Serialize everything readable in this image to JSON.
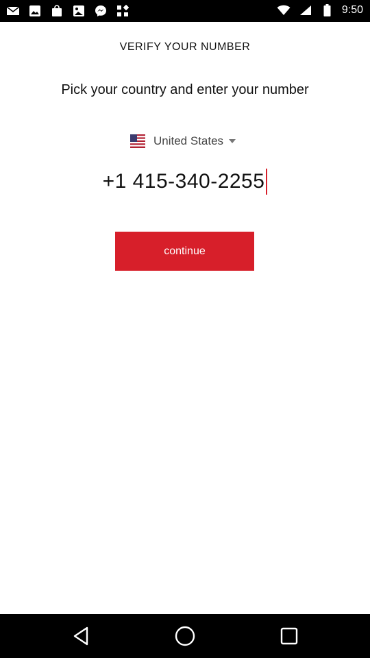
{
  "status_bar": {
    "time": "9:50",
    "left_icons": [
      "mail-icon",
      "image-icon",
      "bag-icon",
      "photo-icon",
      "messenger-icon",
      "grid-icon"
    ],
    "right_icons": [
      "wifi-icon",
      "signal-icon",
      "battery-icon"
    ]
  },
  "page": {
    "title": "VERIFY YOUR NUMBER",
    "subtitle": "Pick your country and enter your number"
  },
  "country": {
    "flag": "us-flag-icon",
    "name": "United States"
  },
  "phone": {
    "value": "+1 415-340-2255"
  },
  "actions": {
    "continue_label": "continue"
  },
  "colors": {
    "accent": "#d71f2a",
    "status_bar": "#000000",
    "nav_bar": "#000000"
  },
  "nav_bar": {
    "buttons": [
      "back-icon",
      "home-icon",
      "recents-icon"
    ]
  }
}
